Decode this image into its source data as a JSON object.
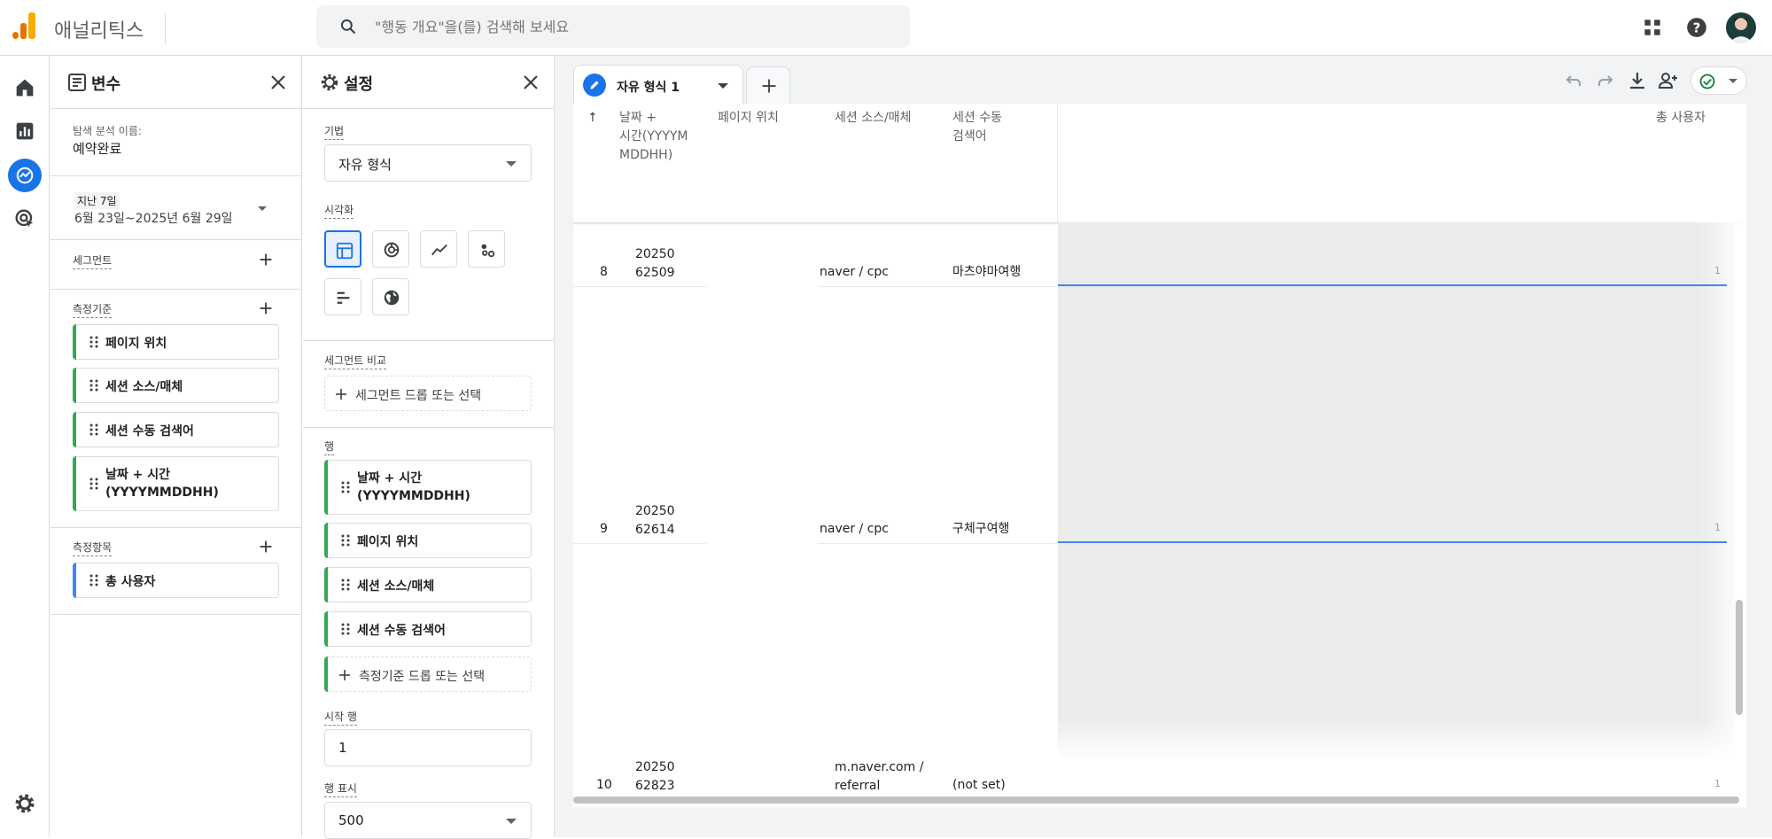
{
  "app": {
    "name": "애널리틱스"
  },
  "search": {
    "placeholder": "\"행동 개요\"을(를) 검색해 보세요"
  },
  "variables": {
    "title": "변수",
    "exploration_label": "탐색 분석 이름:",
    "exploration_name": "예약완료",
    "date_range_label": "지난 7일",
    "date_range_value": "6월 23일~2025년 6월 29일",
    "segments_label": "세그먼트",
    "dimensions_label": "측정기준",
    "dimensions": [
      "페이지 위치",
      "세션 소스/매체",
      "세션 수동 검색어",
      "날짜 + 시간\n(YYYYMMDDHH)"
    ],
    "metrics_label": "측정항목",
    "metrics": [
      "총 사용자"
    ]
  },
  "settings": {
    "title": "설정",
    "technique_label": "기법",
    "technique_value": "자유 형식",
    "visualization_label": "시각화",
    "segment_compare_label": "세그먼트 비교",
    "segment_drop_text": "세그먼트 드롭 또는 선택",
    "rows_label": "행",
    "rows": [
      "날짜 + 시간\n(YYYYMMDDHH)",
      "페이지 위치",
      "세션 소스/매체",
      "세션 수동 검색어"
    ],
    "dimension_drop_text": "측정기준 드롭 또는 선택",
    "start_row_label": "시작 행",
    "start_row_value": "1",
    "show_rows_label": "행 표시",
    "show_rows_value": "500"
  },
  "tab": {
    "label": "자유 형식 1"
  },
  "table": {
    "sort_icon": "↑",
    "headers": {
      "datetime": "날짜 +\n시간(YYYYM\nMDDHH)",
      "page": "페이지 위치",
      "source": "세션 소스/매체",
      "keyword": "세션 수동\n검색어",
      "users": "총 사용자"
    },
    "rows": [
      {
        "num": "8",
        "date": "20250\n62509",
        "source": "naver / cpc",
        "keyword": "마츠야마여행",
        "users": "1"
      },
      {
        "num": "9",
        "date": "20250\n62614",
        "source": "naver / cpc",
        "keyword": "구체구여행",
        "users": "1"
      },
      {
        "num": "10",
        "date": "20250\n62823",
        "source": "m.naver.com /\nreferral",
        "keyword": "(not set)",
        "users": "1"
      }
    ]
  },
  "colors": {
    "accent": "#1a73e8",
    "dimension_bar": "#34a853",
    "metric_bar": "#4285f4"
  }
}
